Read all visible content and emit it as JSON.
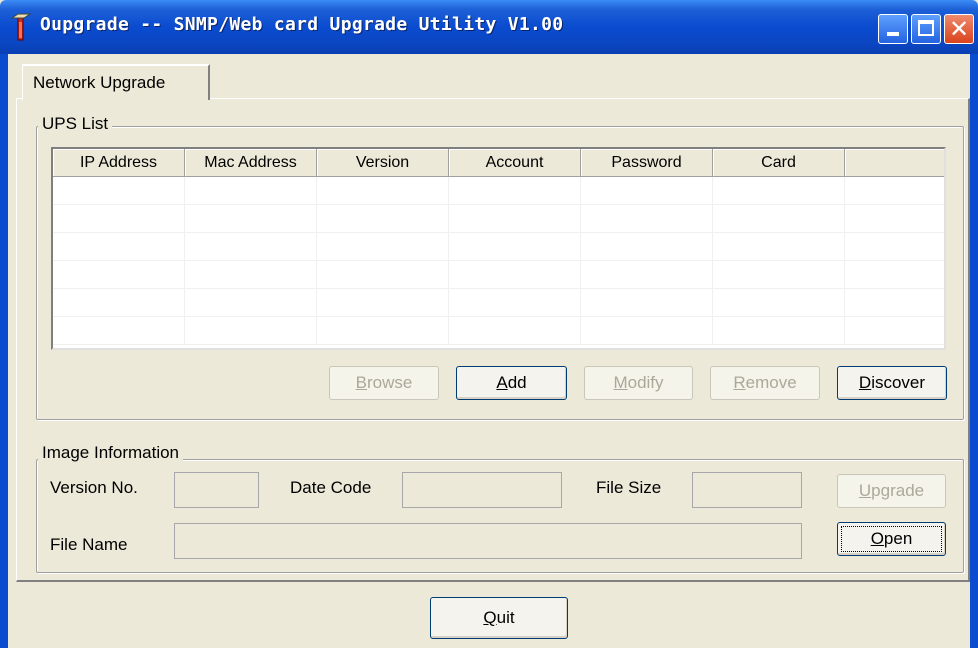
{
  "window": {
    "title": "Oupgrade -- SNMP/Web card Upgrade Utility V1.00",
    "icon": "app-icon",
    "controls": {
      "minimize": "minimize-icon",
      "maximize": "maximize-icon",
      "close_glyph": "✕"
    }
  },
  "tabs": [
    {
      "label": "Network Upgrade",
      "active": true
    }
  ],
  "ups_list": {
    "title": "UPS List",
    "columns": [
      "IP Address",
      "Mac Address",
      "Version",
      "Account",
      "Password",
      "Card",
      ""
    ],
    "rows": [],
    "buttons": {
      "browse": {
        "label": "Browse",
        "mnemonic": "B",
        "enabled": false
      },
      "add": {
        "label": "Add",
        "mnemonic": "A",
        "enabled": true
      },
      "modify": {
        "label": "Modify",
        "mnemonic": "M",
        "enabled": false
      },
      "remove": {
        "label": "Remove",
        "mnemonic": "R",
        "enabled": false
      },
      "discover": {
        "label": "Discover",
        "mnemonic": "D",
        "enabled": true
      }
    }
  },
  "image_information": {
    "title": "Image Information",
    "version_label": "Version No.",
    "version_value": "",
    "date_code_label": "Date Code",
    "date_code_value": "",
    "file_size_label": "File Size",
    "file_size_value": "",
    "file_name_label": "File Name",
    "file_name_value": "",
    "upgrade_button": {
      "label": "Upgrade",
      "mnemonic": "U",
      "enabled": false
    },
    "open_button": {
      "label": "Open",
      "mnemonic": "O",
      "enabled": true
    }
  },
  "quit_button": {
    "label": "Quit",
    "mnemonic": "Q"
  },
  "colors": {
    "titlebar": "#0a4bd0",
    "face": "#ece9d8",
    "disabled_text": "#aca899"
  }
}
